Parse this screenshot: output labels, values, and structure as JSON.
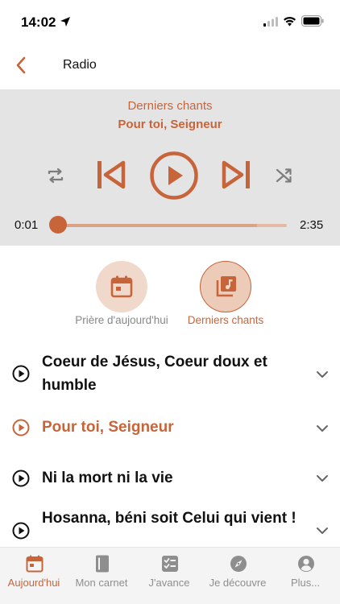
{
  "status_bar": {
    "time": "14:02"
  },
  "nav": {
    "title": "Radio"
  },
  "player": {
    "category": "Derniers chants",
    "track": "Pour toi, Seigneur",
    "time_current": "0:01",
    "time_total": "2:35",
    "progress_fraction": 0.006,
    "buffered_fraction": 0.87
  },
  "quick_tabs": [
    {
      "label": "Prière d'aujourd'hui",
      "icon": "calendar-icon",
      "active": false
    },
    {
      "label": "Derniers chants",
      "icon": "music-library-icon",
      "active": true
    }
  ],
  "songs": [
    {
      "title": "Coeur de Jésus, Coeur doux et humble",
      "current": false
    },
    {
      "title": "Pour toi, Seigneur",
      "current": true
    },
    {
      "title": "Ni la mort ni la vie",
      "current": false
    },
    {
      "title": "Hosanna, béni soit Celui qui vient !",
      "current": false
    }
  ],
  "tab_bar": [
    {
      "label": "Aujourd'hui",
      "icon": "calendar-icon",
      "active": true
    },
    {
      "label": "Mon carnet",
      "icon": "notebook-icon",
      "active": false
    },
    {
      "label": "J'avance",
      "icon": "checklist-icon",
      "active": false
    },
    {
      "label": "Je découvre",
      "icon": "compass-icon",
      "active": false
    },
    {
      "label": "Plus...",
      "icon": "profile-icon",
      "active": false
    }
  ],
  "colors": {
    "accent": "#c8643a",
    "accent_light": "#f0d8cb",
    "player_bg": "#e4e4e4",
    "tab_bar_bg": "#f4f4f4"
  }
}
